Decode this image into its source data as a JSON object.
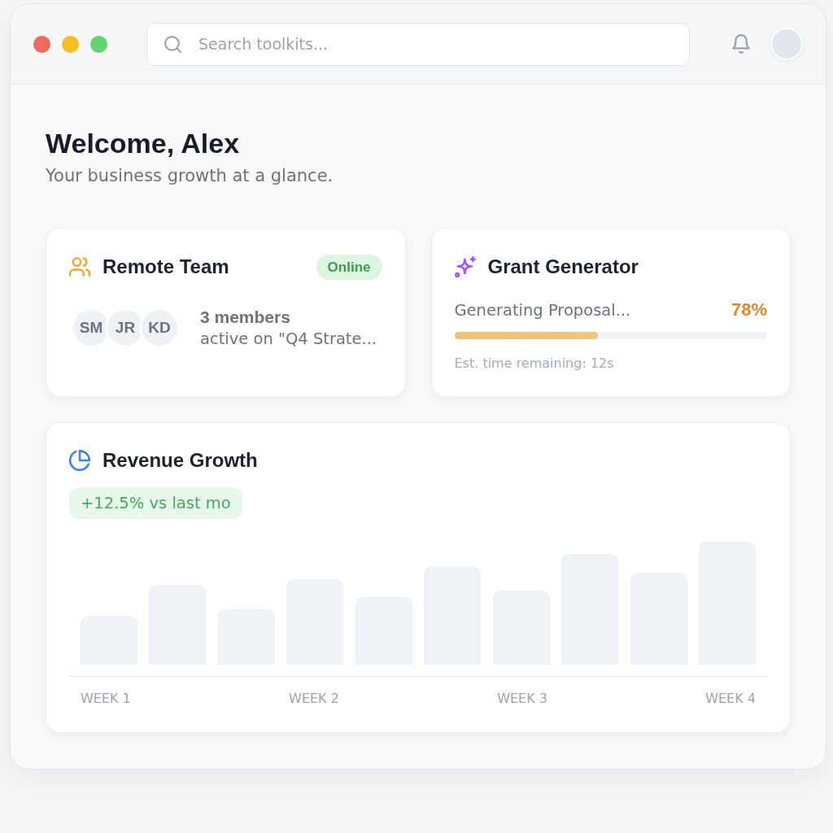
{
  "header": {
    "search": {
      "placeholder": "Search toolkits..."
    }
  },
  "welcome": {
    "title": "Welcome, Alex",
    "subtitle": "Your business growth at a glance."
  },
  "remote_team": {
    "title": "Remote Team",
    "status": "Online",
    "members": [
      {
        "initials": "SM"
      },
      {
        "initials": "JR"
      },
      {
        "initials": "KD"
      }
    ],
    "count": "3 members",
    "activity": "active on \"Q4 Strate..."
  },
  "grant_generator": {
    "title": "Grant Generator",
    "task": "Generating Proposal...",
    "percent": "78%",
    "level": 0.46,
    "eta": "Est. time remaining: 12s"
  },
  "revenue_growth": {
    "title": "Revenue Growth",
    "change": "+12.5% vs last mo",
    "x_labels": [
      "WEEK 1",
      "WEEK 2",
      "WEEK 3",
      "WEEK 4"
    ]
  }
}
